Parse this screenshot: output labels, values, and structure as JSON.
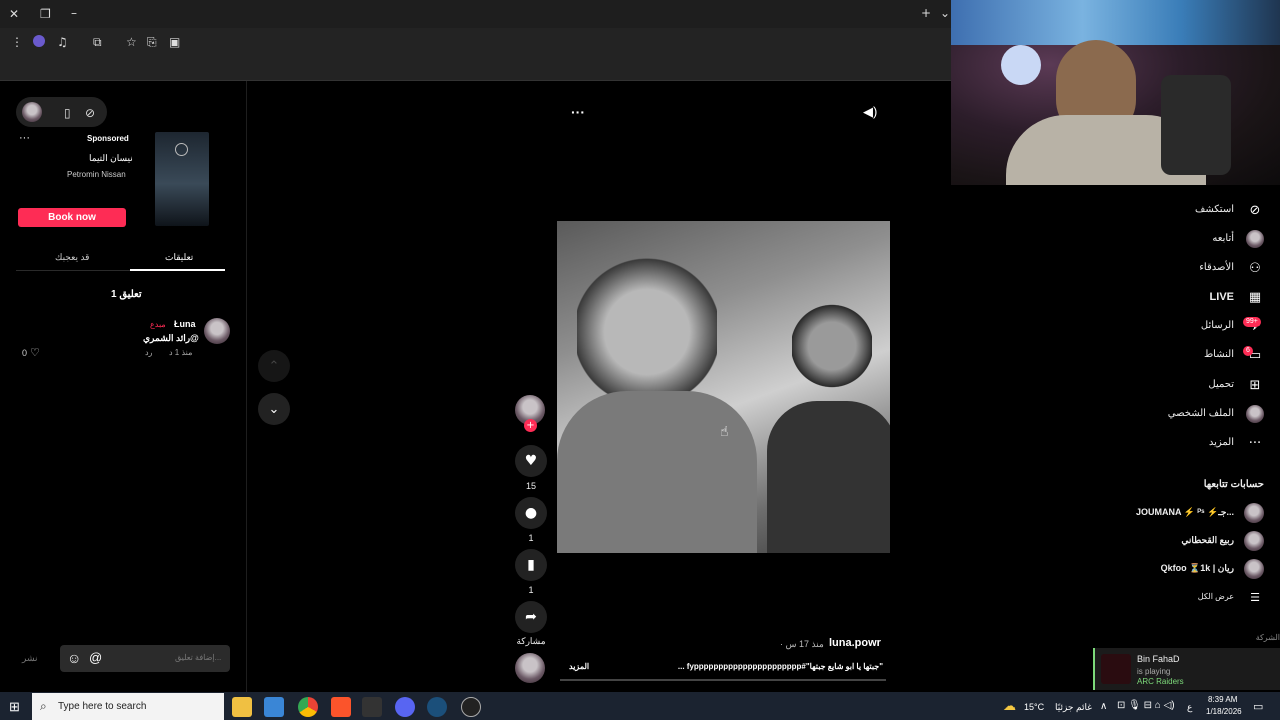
{
  "ad": {
    "sponsored": "Sponsored",
    "title": "نيسان التيما",
    "subtitle": "Petromin Nissan",
    "cta": "Book now"
  },
  "tabs": {
    "comments": "تعليقات",
    "you_may_like": "قد يعجبك"
  },
  "comments": {
    "count_label": "1 تعليق",
    "items": [
      {
        "author": "Łuna",
        "badge": "مبدع",
        "text": "@رائد الشمري",
        "time": "منذ 1 د",
        "reply": "رد",
        "likes": "0"
      }
    ],
    "input_placeholder": "إضافة تعليق...",
    "post": "نشر"
  },
  "video": {
    "likes": "15",
    "comments": "1",
    "saves": "1",
    "share": "مشاركة",
    "author": "luna.powr",
    "time": "· منذ 17 س",
    "caption": "\"جبتها يا ابو شايع جبتها\"#fypppppppppppppppppppppp ...",
    "more": "المزيد"
  },
  "sidebar": {
    "items": [
      {
        "label": "استكشف",
        "icon": "compass-icon"
      },
      {
        "label": "أتابعه",
        "icon": "following-avatar-icon"
      },
      {
        "label": "الأصدقاء",
        "icon": "friends-icon"
      },
      {
        "label": "LIVE",
        "icon": "live-icon"
      },
      {
        "label": "الرسائل",
        "icon": "messages-icon",
        "badge": "99+"
      },
      {
        "label": "النشاط",
        "icon": "activity-icon",
        "badge": "6"
      },
      {
        "label": "تحميل",
        "icon": "upload-icon"
      },
      {
        "label": "الملف الشخصي",
        "icon": "profile-avatar-icon"
      },
      {
        "label": "المزيد",
        "icon": "more-icon"
      }
    ],
    "following_title": "حسابات تتابعها",
    "following": [
      {
        "name": "JOUMANA ⚡ ᴾˢ ⚡جـ..."
      },
      {
        "name": "ربيع القحطاني"
      },
      {
        "name": "Qkfoo ⏳1k | ريان"
      }
    ],
    "show_all": "عرض الكل",
    "company": "الشركة"
  },
  "overlay": {
    "name": "Bin FahaD",
    "status": "is playing",
    "game": "ARC Raiders"
  },
  "taskbar": {
    "search": "Type here to search",
    "weather": "15°C",
    "weather_desc": "غائم جزئيًا",
    "time": "8:39 AM",
    "date": "1/18/2026",
    "lang": "ع"
  },
  "colors": {
    "accent": "#fe2c55",
    "overlay_accent": "#7dd97a"
  }
}
